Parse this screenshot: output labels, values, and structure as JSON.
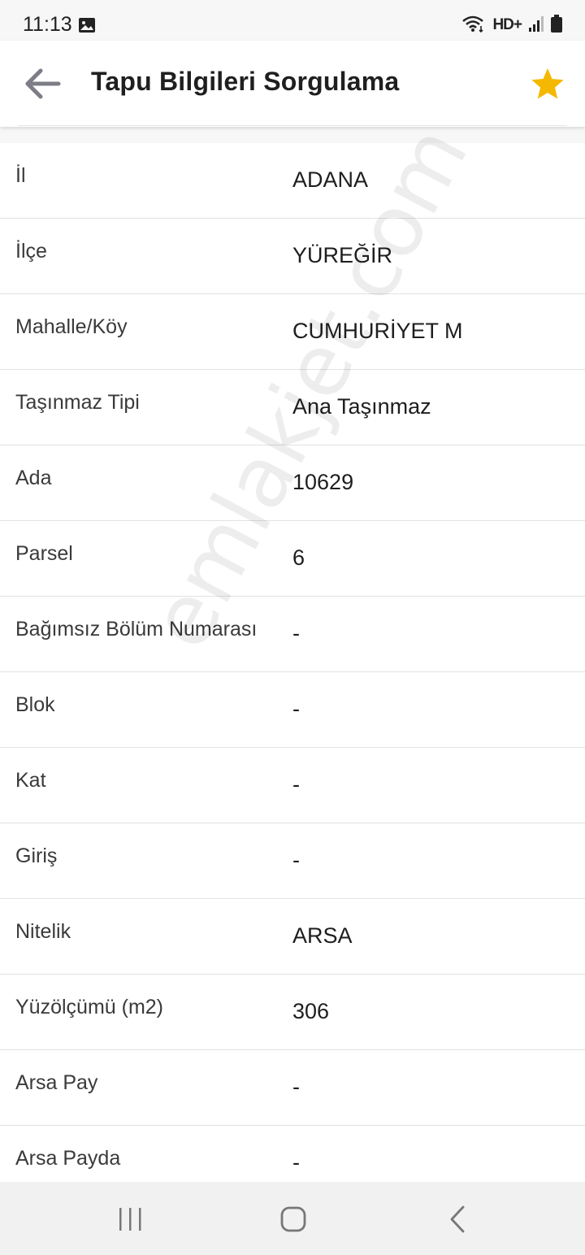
{
  "status_bar": {
    "time": "11:13",
    "network_label": "HD+",
    "icons": [
      "gallery-icon",
      "wifi-icon",
      "hd-voice-icon",
      "signal-icon",
      "battery-icon"
    ]
  },
  "app_bar": {
    "title": "Tapu Bilgileri Sorgulama",
    "back_icon": "arrow-left-icon",
    "favorite_icon": "star-icon",
    "accent_color": "#f5b800"
  },
  "rows": [
    {
      "label": "İl",
      "value": "ADANA"
    },
    {
      "label": "İlçe",
      "value": "YÜREĞİR"
    },
    {
      "label": "Mahalle/Köy",
      "value": "CUMHURİYET M"
    },
    {
      "label": "Taşınmaz Tipi",
      "value": "Ana Taşınmaz"
    },
    {
      "label": "Ada",
      "value": "10629"
    },
    {
      "label": "Parsel",
      "value": "6"
    },
    {
      "label": "Bağımsız Bölüm Numarası",
      "value": "-"
    },
    {
      "label": "Blok",
      "value": "-"
    },
    {
      "label": "Kat",
      "value": "-"
    },
    {
      "label": "Giriş",
      "value": "-"
    },
    {
      "label": "Nitelik",
      "value": "ARSA"
    },
    {
      "label": "Yüzölçümü (m2)",
      "value": "306"
    },
    {
      "label": "Arsa Pay",
      "value": "-"
    },
    {
      "label": "Arsa Payda",
      "value": "-"
    }
  ],
  "watermark": "emlakjet.com",
  "nav_bar": {
    "icons": [
      "recent-apps-icon",
      "home-icon",
      "back-icon"
    ]
  }
}
